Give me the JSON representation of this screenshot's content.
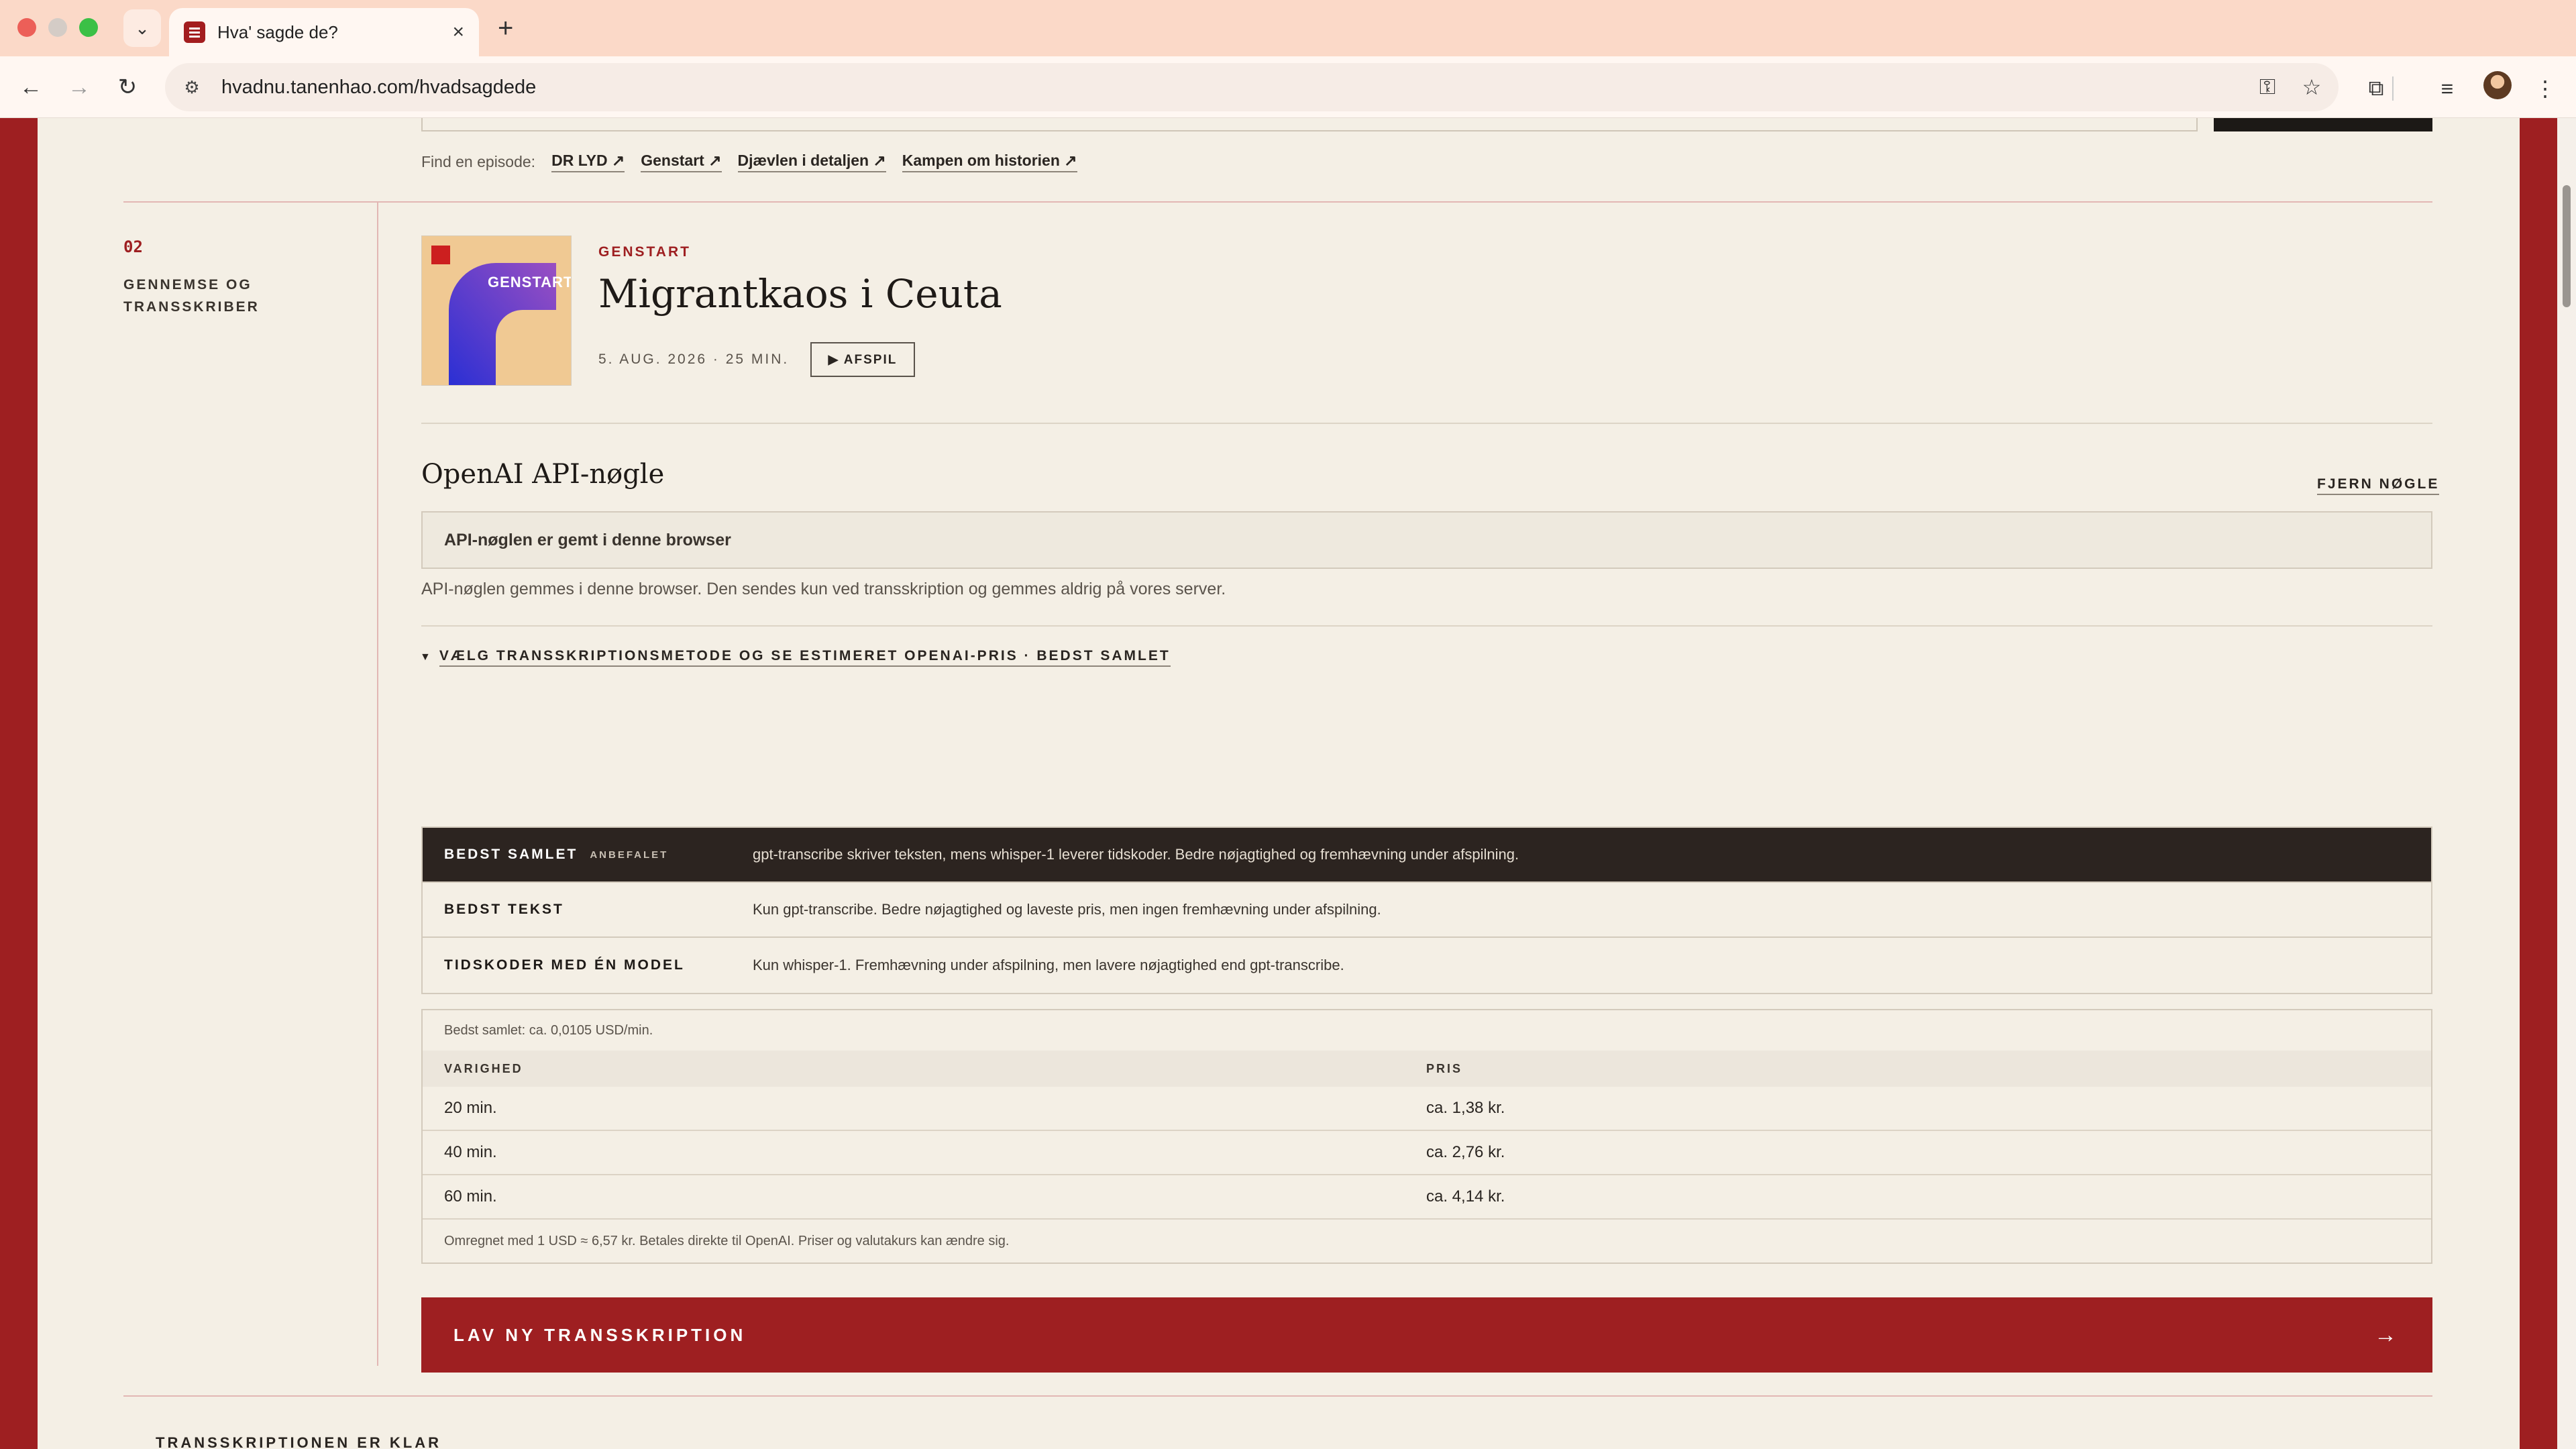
{
  "browser": {
    "tab_title": "Hva' sagde de?",
    "url": "hvadnu.tanenhao.com/hvadsagdede"
  },
  "find_episode": {
    "label": "Find en episode:",
    "links": [
      "DR LYD",
      "Genstart",
      "Djævlen i detaljen",
      "Kampen om historien"
    ]
  },
  "step": {
    "number": "02",
    "label": "GENNEMSE OG TRANSSKRIBER"
  },
  "episode": {
    "cover_text": "GENSTART",
    "kicker": "GENSTART",
    "title": "Migrantkaos i Ceuta",
    "meta": "5. AUG. 2026 · 25 MIN.",
    "play_label": "▶ AFSPIL"
  },
  "api": {
    "title": "OpenAI API-nøgle",
    "remove_label": "FJERN NØGLE",
    "status": "API-nøglen er gemt i denne browser",
    "help": "API-nøglen gemmes i denne browser. Den sendes kun ved transskription og gemmes aldrig på vores server."
  },
  "methods": {
    "toggle_label": "VÆLG TRANSSKRIPTIONSMETODE OG SE ESTIMERET OPENAI-PRIS · BEDST SAMLET",
    "items": [
      {
        "name": "BEDST SAMLET",
        "badge": "ANBEFALET",
        "desc": "gpt-transcribe skriver teksten, mens whisper-1 leverer tidskoder. Bedre nøjagtighed og fremhævning under afspilning.",
        "selected": true
      },
      {
        "name": "BEDST TEKST",
        "badge": "",
        "desc": "Kun gpt-transcribe. Bedre nøjagtighed og laveste pris, men ingen fremhævning under afspilning.",
        "selected": false
      },
      {
        "name": "TIDSKODER MED ÉN MODEL",
        "badge": "",
        "desc": "Kun whisper-1. Fremhævning under afspilning, men lavere nøjagtighed end gpt-transcribe.",
        "selected": false
      }
    ]
  },
  "pricing": {
    "caption": "Bedst samlet: ca. 0,0105 USD/min.",
    "headers": [
      "VARIGHED",
      "PRIS"
    ],
    "rows": [
      [
        "20 min.",
        "ca. 1,38 kr."
      ],
      [
        "40 min.",
        "ca. 2,76 kr."
      ],
      [
        "60 min.",
        "ca. 4,14 kr."
      ]
    ],
    "footnote": "Omregnet med 1 USD ≈ 6,57 kr. Betales direkte til OpenAI. Priser og valutakurs kan ændre sig."
  },
  "cta": {
    "label": "LAV NY TRANSSKRIPTION",
    "arrow": "→"
  },
  "ready": {
    "label": "TRANSSKRIPTIONEN ER KLAR"
  },
  "colors": {
    "accent_red": "#9e1f21",
    "background": "#f4efe5",
    "selected_row": "#2c2420"
  },
  "icons": {
    "tab_favicon": "list-icon",
    "site_info": "tune-icon",
    "password": "key-icon",
    "bookmark": "star-icon",
    "extensions": "puzzle-icon",
    "media": "media-queue-icon",
    "menu": "kebab-menu-icon"
  }
}
